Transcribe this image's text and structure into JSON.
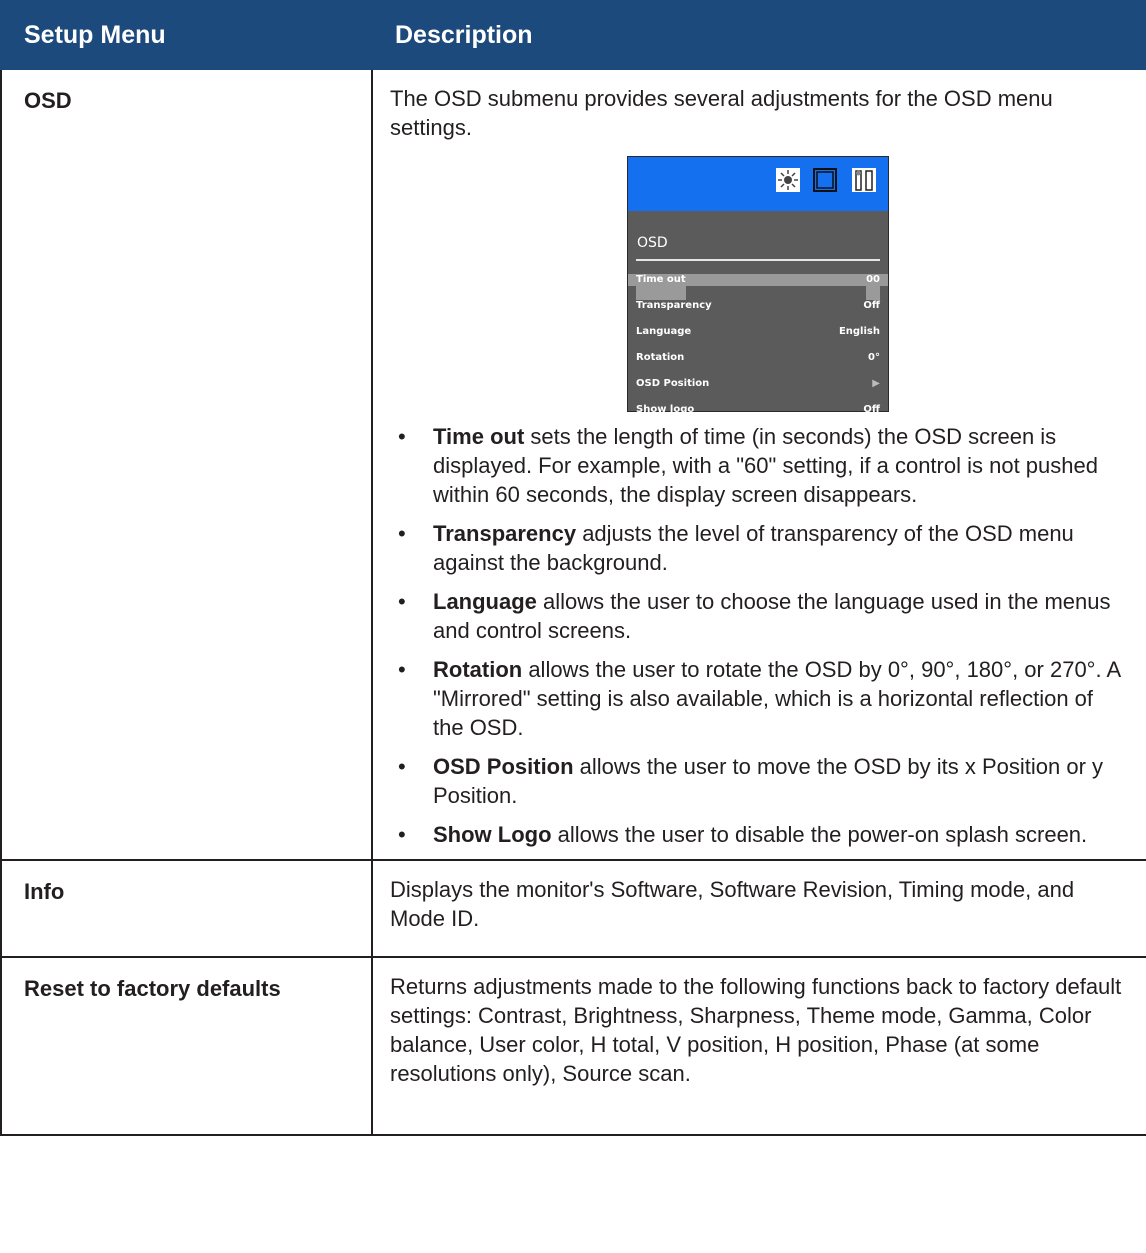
{
  "header": {
    "col1": "Setup Menu",
    "col2": "Description"
  },
  "rows": {
    "osd": {
      "label": "OSD",
      "intro": "The OSD submenu provides several adjustments for the OSD menu settings.",
      "screen": {
        "title": "OSD",
        "top_color": "#1570f0",
        "icons": [
          "brightness-sun-icon",
          "monitor-icon",
          "tools-icon"
        ],
        "items": [
          {
            "label": "Time out",
            "value": "00"
          },
          {
            "label": "Transparency",
            "value": "Off"
          },
          {
            "label": "Language",
            "value": "English"
          },
          {
            "label": "Rotation",
            "value": "0°"
          },
          {
            "label": "OSD Position",
            "value": "▶"
          },
          {
            "label": "Show logo",
            "value": "Off"
          }
        ]
      },
      "bullets": [
        {
          "term": "Time out",
          "text": " sets the length of time (in seconds) the OSD screen is displayed.  For example, with a \"60\" setting, if a control is not pushed within 60 seconds, the display screen disappears."
        },
        {
          "term": "Transparency",
          "text": " adjusts the level of transparency of the OSD menu against the background."
        },
        {
          "term": "Language",
          "text": " allows the user to choose the language used in the menus and control screens."
        },
        {
          "term": "Rotation",
          "text": " allows the user to rotate the OSD by 0°, 90°, 180°, or 270°.  A \"Mirrored\" setting is also available, which is a horizontal reflection of the OSD."
        },
        {
          "term": "OSD Position",
          "text": " allows the user to move the OSD by its x Position or y Position."
        },
        {
          "term": "Show Logo",
          "text": " allows the user to disable the power-on splash screen."
        }
      ]
    },
    "info": {
      "label": "Info",
      "text": "Displays the monitor's Software, Software Revision, Timing mode, and Mode ID."
    },
    "reset": {
      "label": "Reset to factory defaults",
      "text": "Returns adjustments made to the following functions back to factory default settings: Contrast, Brightness, Sharpness, Theme mode, Gamma, Color balance, User color, H total, V position, H position, Phase (at some resolutions only), Source scan."
    }
  },
  "colors": {
    "header_bg": "#1c4a7c",
    "header_text": "#ffffff",
    "border": "#231f20"
  }
}
